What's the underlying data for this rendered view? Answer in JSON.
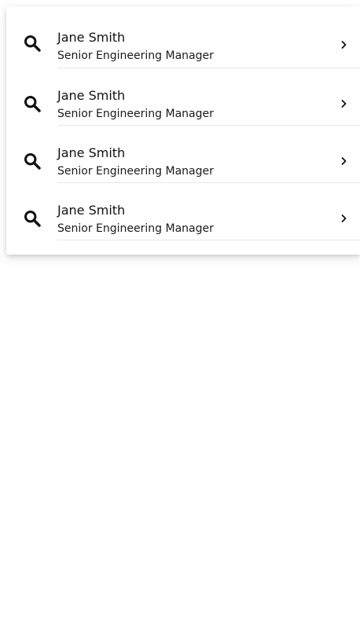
{
  "results": {
    "items": [
      {
        "icon": "search-icon",
        "name": "Jane Smith",
        "subtitle": "Senior Engineering Manager",
        "chevron": "chevron-right-icon"
      },
      {
        "icon": "search-icon",
        "name": "Jane Smith",
        "subtitle": "Senior Engineering Manager",
        "chevron": "chevron-right-icon"
      },
      {
        "icon": "search-icon",
        "name": "Jane Smith",
        "subtitle": "Senior Engineering Manager",
        "chevron": "chevron-right-icon"
      },
      {
        "icon": "search-icon",
        "name": "Jane Smith",
        "subtitle": "Senior Engineering Manager",
        "chevron": "chevron-right-icon"
      }
    ]
  },
  "colors": {
    "text_primary": "#111111",
    "divider": "#e8e8e8",
    "background": "#ffffff"
  }
}
